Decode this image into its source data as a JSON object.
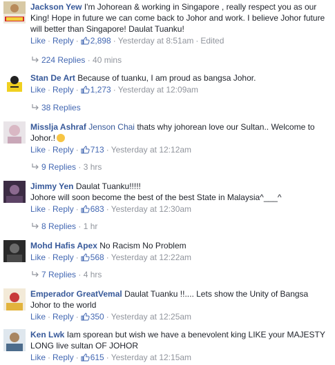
{
  "comments": [
    {
      "author": "Jackson Yew",
      "text": "I'm Johorean & working in Singapore , really respect you as our King! Hope in future we can come back to Johor and work. I believe Johor future will better than Singapore! Daulat Tuanku!",
      "like": "Like",
      "reply": "Reply",
      "likes": "2,898",
      "time": "Yesterday at 8:51am",
      "edited": "Edited",
      "replies_label": "224 Replies",
      "replies_time": "40 mins"
    },
    {
      "author": "Stan De Art",
      "text": "Because of tuanku, I am proud as bangsa Johor.",
      "like": "Like",
      "reply": "Reply",
      "likes": "1,273",
      "time": "Yesterday at 12:09am",
      "replies_label": "38 Replies"
    },
    {
      "author": "Misslja Ashraf",
      "tag": "Jenson Chai",
      "text": "thats why johorean love our Sultan.. Welcome to Johor.!",
      "like": "Like",
      "reply": "Reply",
      "likes": "713",
      "time": "Yesterday at 12:12am",
      "replies_label": "9 Replies",
      "replies_time": "3 hrs"
    },
    {
      "author": "Jimmy Yen",
      "text": "Daulat Tuanku!!!!!",
      "text2": "Johore will soon become the best of the best State in Malaysia^___^",
      "like": "Like",
      "reply": "Reply",
      "likes": "683",
      "time": "Yesterday at 12:30am",
      "replies_label": "8 Replies",
      "replies_time": "1 hr"
    },
    {
      "author": "Mohd Hafis Apex",
      "text": "No Racism No Problem",
      "like": "Like",
      "reply": "Reply",
      "likes": "568",
      "time": "Yesterday at 12:22am",
      "replies_label": "7 Replies",
      "replies_time": "4 hrs"
    },
    {
      "author": "Emperador GreatVemal",
      "text": "Daulat Tuanku !!.... Lets show the Unity of Bangsa Johor to the world",
      "like": "Like",
      "reply": "Reply",
      "likes": "350",
      "time": "Yesterday at 12:25am"
    },
    {
      "author": "Ken Lwk",
      "text": "Iam sporean but wish we have a benevolent king LIKE your MAJESTY LONG live sultan OF JOHOR",
      "like": "Like",
      "reply": "Reply",
      "likes": "615",
      "time": "Yesterday at 12:15am"
    }
  ],
  "icons": {
    "like": "thumbs-up-icon",
    "replies": "reply-arrow-icon"
  },
  "colors": {
    "link": "#365899",
    "action": "#4267b2",
    "muted": "#90949c",
    "text": "#1d2129"
  }
}
